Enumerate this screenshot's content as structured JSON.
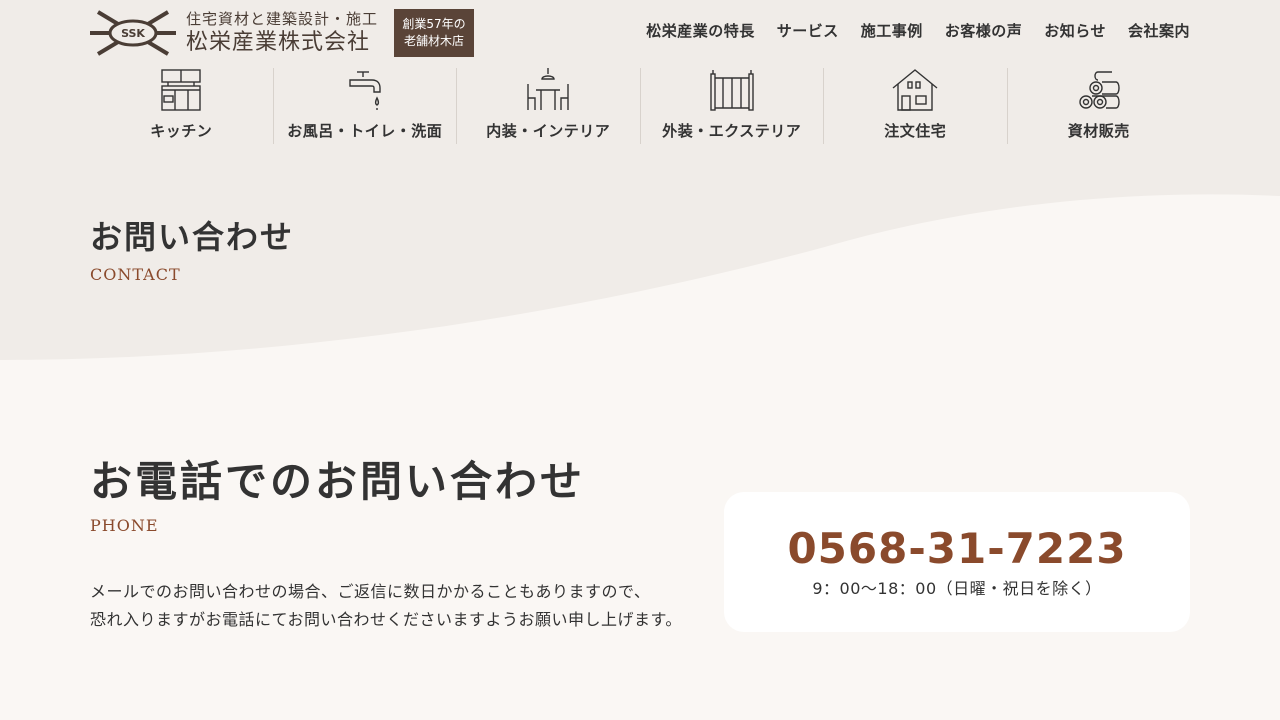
{
  "header": {
    "logo_mark_text": "SSK",
    "logo_sub": "住宅資材と建築設計・施工",
    "logo_name": "松栄産業株式会社",
    "badge_line1": "創業57年の",
    "badge_line2": "老舗材木店",
    "nav": [
      "松栄産業の特長",
      "サービス",
      "施工事例",
      "お客様の声",
      "お知らせ",
      "会社案内"
    ]
  },
  "categories": [
    {
      "label": "キッチン",
      "icon": "kitchen-icon"
    },
    {
      "label": "お風呂・トイレ・洗面",
      "icon": "faucet-icon"
    },
    {
      "label": "内装・インテリア",
      "icon": "dining-icon"
    },
    {
      "label": "外装・エクステリア",
      "icon": "fence-icon"
    },
    {
      "label": "注文住宅",
      "icon": "house-icon"
    },
    {
      "label": "資材販売",
      "icon": "lumber-icon"
    }
  ],
  "hero": {
    "title": "お問い合わせ",
    "subtitle": "CONTACT"
  },
  "phone": {
    "title": "お電話でのお問い合わせ",
    "subtitle": "PHONE",
    "desc_line1": "メールでのお問い合わせの場合、ご返信に数日かかることもありますので、",
    "desc_line2": "恐れ入りますがお電話にてお問い合わせくださいますようお願い申し上げます。",
    "number": "0568-31-7223",
    "hours": "9：00〜18：00（日曜・祝日を除く）"
  },
  "colors": {
    "accent": "#8a4a2c",
    "badge_bg": "#5a4438",
    "band_bg": "#f0ece8",
    "page_bg": "#faf7f4"
  }
}
